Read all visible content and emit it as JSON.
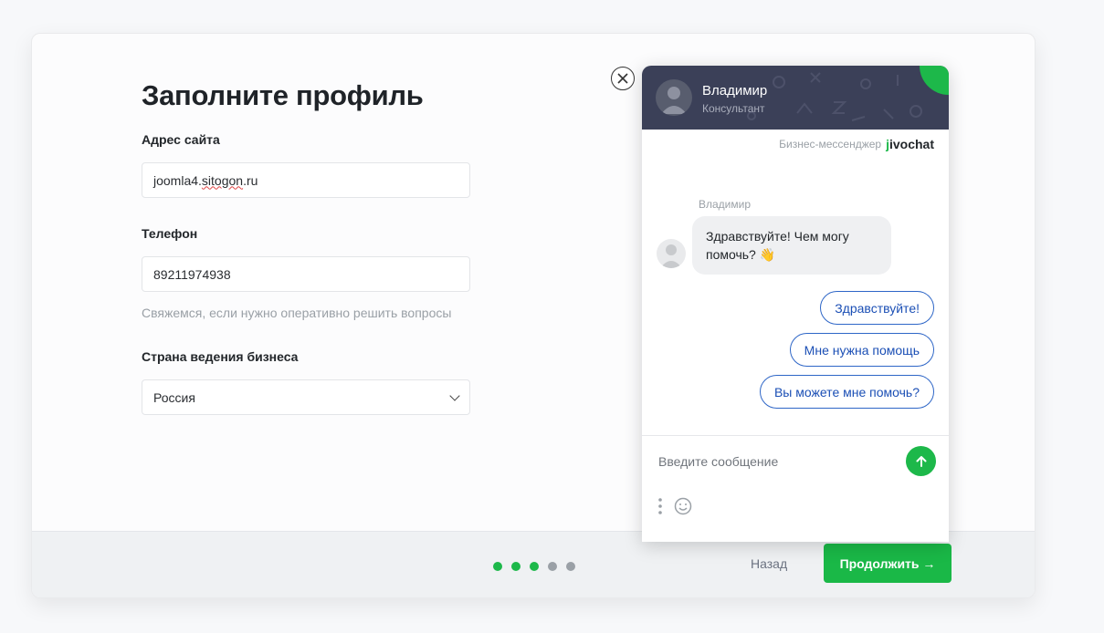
{
  "form": {
    "title": "Заполните профиль",
    "site_label": "Адрес сайта",
    "site_value_prefix": "joomla4.",
    "site_value_spell": "sitogon",
    "site_value_suffix": ".ru",
    "phone_label": "Телефон",
    "phone_value": "89211974938",
    "phone_hint": "Свяжемся, если нужно оперативно решить вопросы",
    "country_label": "Страна ведения бизнеса",
    "country_value": "Россия"
  },
  "footer": {
    "steps_total": 5,
    "steps_done": 3,
    "back_label": "Назад",
    "next_label": "Продолжить →"
  },
  "chat": {
    "operator_name": "Владимир",
    "operator_role": "Консультант",
    "brand_caption": "Бизнес-мессенджер",
    "brand_logo_prefix": "j",
    "brand_logo_rest": "ivochat",
    "message_author": "Владимир",
    "message_text": "Здравствуйте! Чем могу помочь? 👋",
    "quick_replies": [
      "Здравствуйте!",
      "Мне нужна помощь",
      "Вы можете мне помочь?"
    ],
    "input_placeholder": "Введите сообщение",
    "accent_color": "#1db84a",
    "header_color": "#3b4058"
  },
  "icons": {
    "close": "close-icon",
    "send": "arrow-up-icon",
    "more": "more-vertical-icon",
    "emoji": "smile-icon",
    "select": "chevron-down-icon"
  }
}
